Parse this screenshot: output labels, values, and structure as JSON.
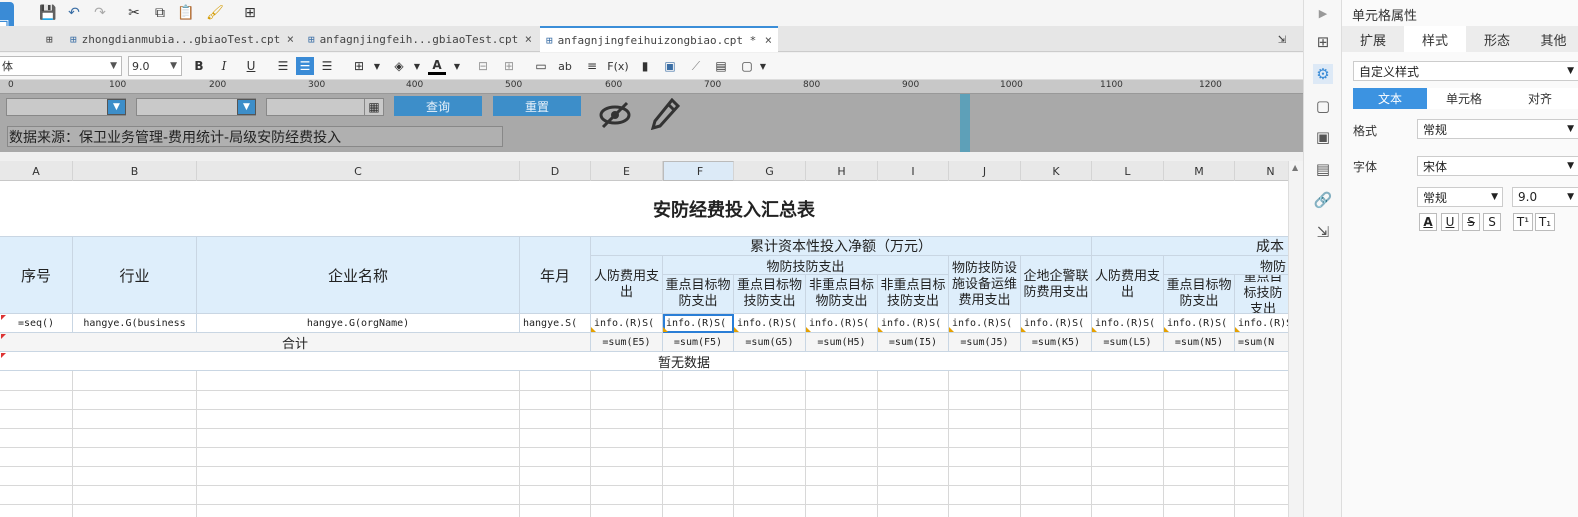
{
  "tabs": [
    {
      "label": "zhongdianmubia...gbiaoTest.cpt",
      "close": "×"
    },
    {
      "label": "anfagnjingfeih...gbiaoTest.cpt",
      "close": "×"
    },
    {
      "label": "anfagnjingfeihuizongbiao.cpt *",
      "close": "×"
    }
  ],
  "format": {
    "font": "体",
    "size": "9.0",
    "bold": "B",
    "italic": "I",
    "underline": "U",
    "fx": "F(x)",
    "ab": "ab",
    "color_letter": "A"
  },
  "ruler": {
    "labels": [
      "0",
      "100",
      "200",
      "300",
      "400",
      "500",
      "600",
      "700",
      "800",
      "900",
      "1000",
      "1100",
      "1200"
    ]
  },
  "params": {
    "query_label": "查询",
    "reset_label": "重置",
    "source_text": "数据来源：保卫业务管理-费用统计-局级安防经费投入"
  },
  "columns": [
    "A",
    "B",
    "C",
    "D",
    "E",
    "F",
    "G",
    "H",
    "I",
    "J",
    "K",
    "L",
    "M",
    "N"
  ],
  "report": {
    "title": "安防经费投入汇总表",
    "h_seq": "序号",
    "h_industry": "行业",
    "h_company": "企业名称",
    "h_yearmonth": "年月",
    "h_capital": "累计资本性投入净额（万元）",
    "h_cost": "成本",
    "h_personnel": "人防费用支出",
    "h_tech": "物防技防支出",
    "h_key_phys": "重点目标物防支出",
    "h_key_tech": "重点目标物技防支出",
    "h_nonkey_phys": "非重点目标物防支出",
    "h_nonkey_tech": "非重点目标技防支出",
    "h_equip": "物防技防设施设备运维费用支出",
    "h_police": "企地企警联防费用支出",
    "h_personnel2": "人防费用支出",
    "h_key_phys2": "重点目标物防支出",
    "h_key_tech2": "重点目标技防支出",
    "h_phys_cut": "物防",
    "f_seq": "=seq()",
    "f_industry": "hangye.G(business",
    "f_company": "hangye.G(orgName)",
    "f_ym": "hangye.S(",
    "f_info": "info.(R)S(",
    "total_label": "合计",
    "sums": [
      "=sum(E5)",
      "=sum(F5)",
      "=sum(G5)",
      "=sum(H5)",
      "=sum(I5)",
      "=sum(J5)",
      "=sum(K5)",
      "=sum(L5)",
      "=sum(N5)",
      "=sum(N"
    ],
    "no_data": "暂无数据"
  },
  "panel": {
    "title": "单元格属性",
    "tabs": [
      "扩展",
      "样式",
      "形态",
      "其他"
    ],
    "style_select": "自定义样式",
    "segs": [
      "文本",
      "单元格",
      "对齐"
    ],
    "format_label": "格式",
    "format_value": "常规",
    "font_label": "字体",
    "font_value": "宋体",
    "font_style": "常规",
    "font_size": "9.0",
    "fmt_buttons": [
      "A",
      "U",
      "S",
      "S",
      "T¹",
      "T₁"
    ]
  }
}
